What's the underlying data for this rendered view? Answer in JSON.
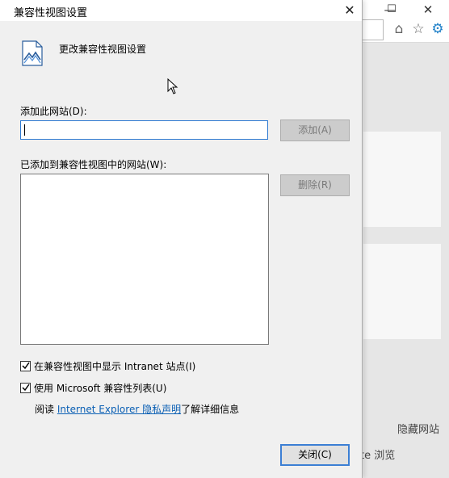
{
  "background": {
    "minimize_glyph": "—",
    "maximize_glyph": "☐",
    "close_glyph": "✕",
    "home_icon": "⌂",
    "favorites_icon": "☆",
    "settings_icon": "⚙",
    "hidden_sites_text": "隐藏网站",
    "browse_text": "te 浏览"
  },
  "dialog": {
    "title": "兼容性视图设置",
    "close_glyph": "✕",
    "header_text": "更改兼容性视图设置",
    "add_site_label": "添加此网站(D):",
    "add_site_value": "",
    "add_button": "添加(A)",
    "added_sites_label": "已添加到兼容性视图中的网站(W):",
    "added_sites": [],
    "remove_button": "删除(R)",
    "checkbox_intranet": {
      "label": "在兼容性视图中显示 Intranet 站点(I)",
      "checked": true
    },
    "checkbox_ms_list": {
      "label": "使用 Microsoft 兼容性列表(U)",
      "checked": true
    },
    "info_prefix": "阅读 ",
    "info_link": "Internet Explorer 隐私声明",
    "info_suffix": "了解详细信息",
    "close_button": "关闭(C)"
  },
  "colors": {
    "accent": "#2f7ad2",
    "link": "#0a5fb4",
    "settings_icon": "#1f80c8"
  }
}
